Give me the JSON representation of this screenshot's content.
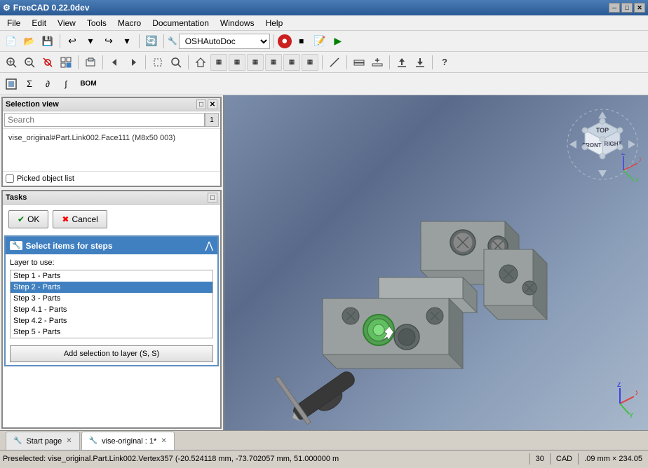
{
  "app": {
    "title": "FreeCAD 0.22.0dev",
    "icon": "🔧"
  },
  "title_bar": {
    "title": "FreeCAD 0.22.0dev",
    "win_min": "─",
    "win_max": "□",
    "win_close": "✕"
  },
  "menu": {
    "items": [
      "File",
      "Edit",
      "View",
      "Tools",
      "Macro",
      "Documentation",
      "Windows",
      "Help"
    ]
  },
  "toolbar1": {
    "buttons": [
      {
        "name": "new",
        "icon": "📄"
      },
      {
        "name": "open",
        "icon": "📂"
      },
      {
        "name": "save",
        "icon": "💾"
      },
      {
        "name": "undo",
        "icon": "↩"
      },
      {
        "name": "redo",
        "icon": "↪"
      },
      {
        "name": "refresh",
        "icon": "🔄"
      }
    ],
    "workbench": "OSHAutoDoc",
    "record_macro": "⏺",
    "stop_macro": "⏹",
    "macro_script": "📝",
    "execute_macro": "▶"
  },
  "toolbar2": {
    "buttons": [
      {
        "name": "selection_zoom",
        "icon": "🔍"
      },
      {
        "name": "zoom_region",
        "icon": "🔍"
      },
      {
        "name": "toggle_visibility",
        "icon": "👁"
      },
      {
        "name": "select_all",
        "icon": "✦"
      },
      {
        "name": "group",
        "icon": "📦"
      },
      {
        "name": "nav_back",
        "icon": "◀"
      },
      {
        "name": "nav_forward",
        "icon": "▶"
      },
      {
        "name": "bounding_box",
        "icon": "⬜"
      },
      {
        "name": "zoom_fit",
        "icon": "🔍"
      },
      {
        "name": "view_home",
        "icon": "⌂"
      },
      {
        "name": "view_front",
        "icon": "▦"
      },
      {
        "name": "view_top",
        "icon": "▦"
      },
      {
        "name": "view_right",
        "icon": "▦"
      },
      {
        "name": "view_left",
        "icon": "▦"
      },
      {
        "name": "view_bottom",
        "icon": "▦"
      },
      {
        "name": "view_back",
        "icon": "▦"
      },
      {
        "name": "measure",
        "icon": "📐"
      },
      {
        "name": "layer_grp",
        "icon": "📋"
      },
      {
        "name": "new_layer",
        "icon": "➕"
      },
      {
        "name": "export",
        "icon": "📤"
      },
      {
        "name": "import",
        "icon": "📥"
      },
      {
        "name": "help",
        "icon": "?"
      }
    ]
  },
  "toolbar3": {
    "buttons": [
      {
        "name": "t1",
        "icon": "▣"
      },
      {
        "name": "t2",
        "icon": "Σ"
      },
      {
        "name": "t3",
        "icon": "∂"
      },
      {
        "name": "t4",
        "icon": "∫"
      },
      {
        "name": "bom",
        "label": "BOM"
      }
    ]
  },
  "selection_view": {
    "title": "Selection view",
    "search_placeholder": "Search",
    "search_count": "1",
    "selected_item": "vise_original#Part.Link002.Face111 (M8x50 003)",
    "picked_object_label": "Picked object list"
  },
  "tasks": {
    "title": "Tasks",
    "ok_label": "✔ OK",
    "cancel_label": "✖ Cancel",
    "select_items_title": "Select items for steps",
    "layer_use_label": "Layer to use:",
    "layers": [
      {
        "name": "Step 1 - Parts",
        "selected": false
      },
      {
        "name": "Step 2 - Parts",
        "selected": true
      },
      {
        "name": "Step 3 - Parts",
        "selected": false
      },
      {
        "name": "Step 4.1 - Parts",
        "selected": false
      },
      {
        "name": "Step 4.2 - Parts",
        "selected": false
      },
      {
        "name": "Step 5 - Parts",
        "selected": false
      }
    ],
    "add_selection_label": "Add selection to layer (S, S)"
  },
  "tabs": [
    {
      "label": "Start page",
      "icon": "🔧",
      "active": false,
      "closable": true
    },
    {
      "label": "vise-original : 1*",
      "icon": "🔧",
      "active": true,
      "closable": true
    }
  ],
  "status_bar": {
    "text": "Preselected: vise_original.Part.Link002.Vertex357 (-20.524118 mm, -73.702057 mm, 51.000000 m",
    "zoom": "30",
    "cad_label": "CAD",
    "measurement": ".09 mm × 234.05"
  },
  "nav_cube": {
    "top": "TOP",
    "front": "FRONT",
    "right": "RIGHT"
  }
}
